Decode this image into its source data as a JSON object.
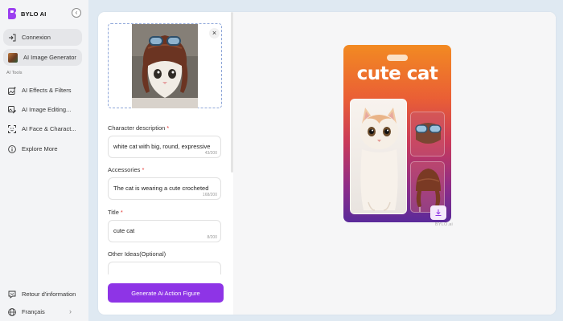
{
  "brand": {
    "name": "BYLO AI"
  },
  "sidebar": {
    "collapse_glyph": "‹",
    "top_items": [
      {
        "label": "Connexion",
        "icon": "login-icon"
      },
      {
        "label": "AI Image Generator",
        "icon": "image-thumbnail-icon"
      }
    ],
    "section_label": "AI Tools",
    "tools": [
      {
        "label": "AI Effects & Filters",
        "icon": "sparkle-image-icon"
      },
      {
        "label": "AI Image Editing...",
        "icon": "image-edit-icon"
      },
      {
        "label": "AI Face & Charact...",
        "icon": "face-scan-icon"
      },
      {
        "label": "Explore More",
        "icon": "info-circle-icon"
      }
    ],
    "bottom_items": [
      {
        "label": "Retour d'information",
        "icon": "feedback-icon"
      },
      {
        "label": "Français",
        "icon": "globe-icon",
        "chevron": "›"
      }
    ]
  },
  "form": {
    "upload": {
      "close_glyph": "×"
    },
    "fields": [
      {
        "label": "Character description",
        "required": true,
        "value": "white cat with big, round, expressive",
        "count": "43/200"
      },
      {
        "label": "Accessories",
        "required": true,
        "value": "The cat is wearing a cute crocheted",
        "count": "168/200"
      },
      {
        "label": "Title",
        "required": true,
        "value": "cute cat",
        "count": "8/200"
      },
      {
        "label": "Other Ideas(Optional)",
        "required": false,
        "value": "",
        "count": ""
      }
    ],
    "required_mark": "*",
    "generate_label": "Generate Ai Action Figure"
  },
  "preview": {
    "card_title": "cute cat",
    "watermark": "BYLO.ai"
  },
  "colors": {
    "accent": "#8e34e6",
    "required": "#e53935",
    "brand_logo": "#9b3ff0"
  }
}
